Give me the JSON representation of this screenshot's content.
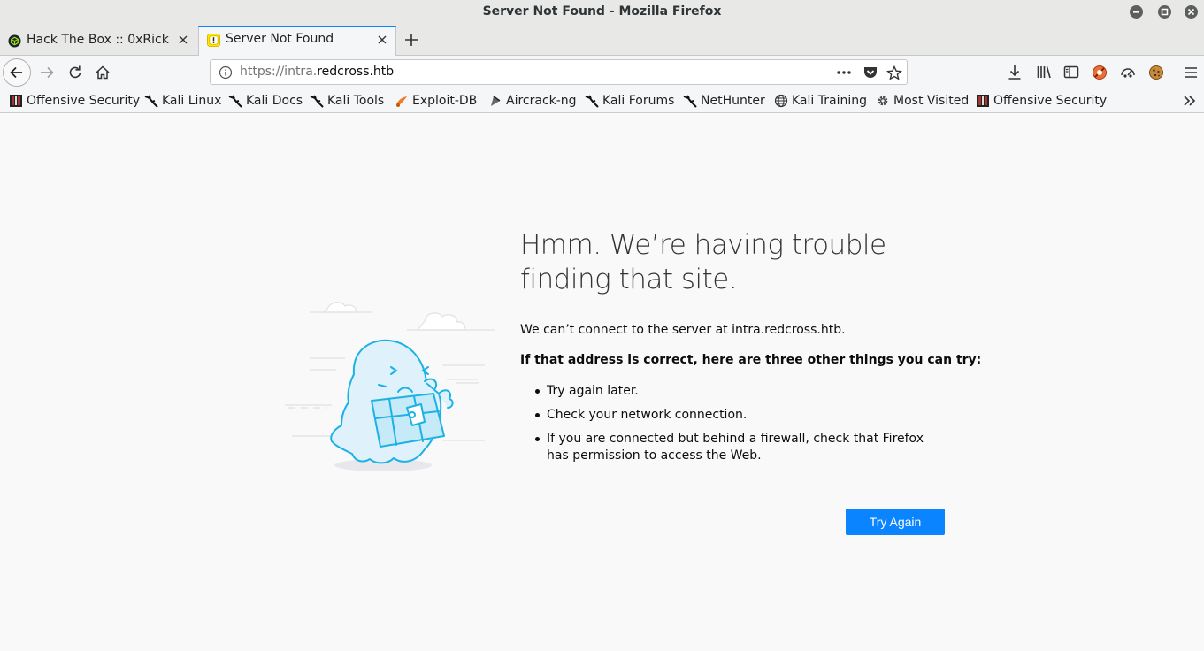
{
  "window": {
    "title": "Server Not Found - Mozilla Firefox"
  },
  "tabs": [
    {
      "label": "Hack The Box :: 0xRick",
      "active": false
    },
    {
      "label": "Server Not Found",
      "active": true
    }
  ],
  "navbar": {
    "url_prefix": "https://intra.",
    "url_domain": "redcross.htb"
  },
  "bookmarks": [
    {
      "label": "Offensive Security",
      "icon": "offsec-icon"
    },
    {
      "label": "Kali Linux",
      "icon": "kali-dragon-icon"
    },
    {
      "label": "Kali Docs",
      "icon": "kali-dragon-icon"
    },
    {
      "label": "Kali Tools",
      "icon": "kali-dragon-icon"
    },
    {
      "label": "Exploit-DB",
      "icon": "exploit-db-icon"
    },
    {
      "label": "Aircrack-ng",
      "icon": "aircrack-icon"
    },
    {
      "label": "Kali Forums",
      "icon": "kali-dragon-icon"
    },
    {
      "label": "NetHunter",
      "icon": "kali-dragon-icon"
    },
    {
      "label": "Kali Training",
      "icon": "globe-icon"
    },
    {
      "label": "Most Visited",
      "icon": "gear-icon"
    },
    {
      "label": "Offensive Security",
      "icon": "offsec-icon"
    }
  ],
  "error": {
    "title": "Hmm. We’re having trouble finding that site.",
    "description": "We can’t connect to the server at intra.redcross.htb.",
    "suggestion_heading": "If that address is correct, here are three other things you can try:",
    "tips": [
      "Try again later.",
      "Check your network connection.",
      "If you are connected but behind a firewall, check that Firefox has permission to access the Web."
    ],
    "button_label": "Try Again"
  },
  "colors": {
    "accent": "#0a84ff",
    "page_bg": "#f9f9fa"
  }
}
